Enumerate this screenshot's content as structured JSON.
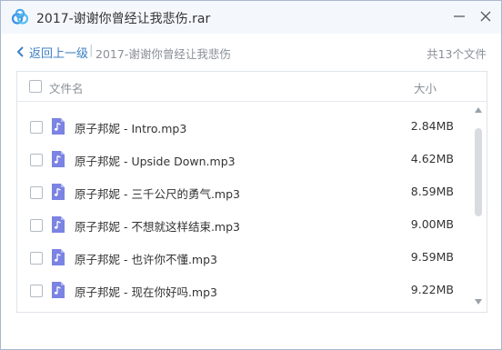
{
  "window": {
    "title": "2017-谢谢你曾经让我悲伤.rar"
  },
  "nav": {
    "back_label": "返回上一级",
    "separator": "|",
    "current_folder": "2017-谢谢你曾经让我悲伤",
    "file_count": "共13个文件"
  },
  "table": {
    "header_name": "文件名",
    "header_size": "大小",
    "rows": [
      {
        "name": "原子邦妮 - Intro.mp3",
        "size": "2.84MB",
        "icon": "audio-file-icon"
      },
      {
        "name": "原子邦妮 - Upside Down.mp3",
        "size": "4.62MB",
        "icon": "audio-file-icon"
      },
      {
        "name": "原子邦妮 - 三千公尺的勇气.mp3",
        "size": "8.59MB",
        "icon": "audio-file-icon"
      },
      {
        "name": "原子邦妮 - 不想就这样结束.mp3",
        "size": "9.00MB",
        "icon": "audio-file-icon"
      },
      {
        "name": "原子邦妮 - 也许你不懂.mp3",
        "size": "9.59MB",
        "icon": "audio-file-icon"
      },
      {
        "name": "原子邦妮 - 现在你好吗.mp3",
        "size": "9.22MB",
        "icon": "audio-file-icon"
      }
    ]
  },
  "colors": {
    "accent": "#3e80c4",
    "file_icon": "#7b83e3",
    "titlebar_bg": "#f4f8fd",
    "border": "#a9b8cc"
  }
}
